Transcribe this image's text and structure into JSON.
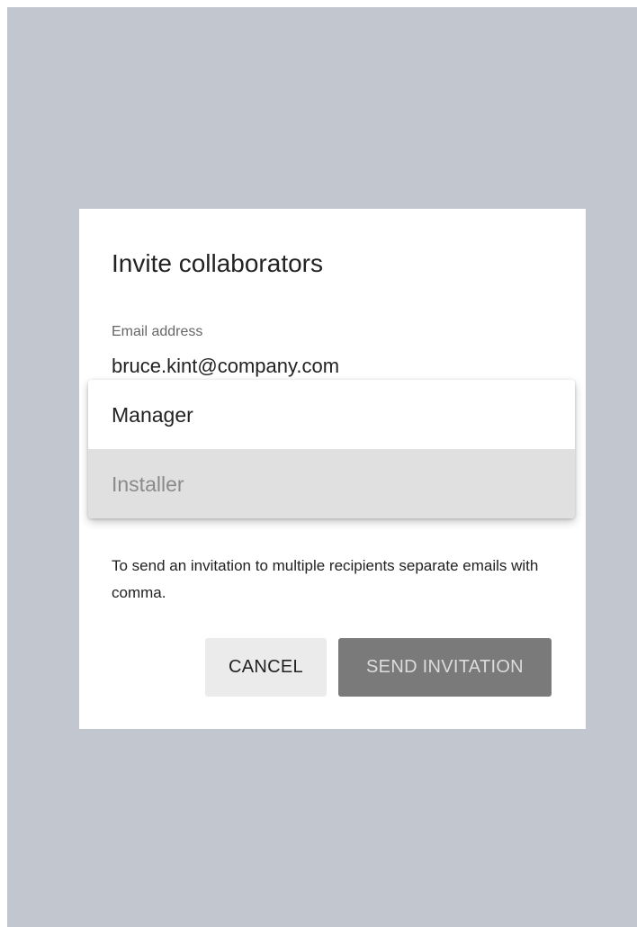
{
  "dialog": {
    "title": "Invite collaborators",
    "email_label": "Email address",
    "email_value": "bruce.kint@company.com",
    "role_menu": {
      "items": [
        {
          "label": "Manager",
          "selected": false
        },
        {
          "label": "Installer",
          "selected": true
        }
      ]
    },
    "helper_text": "To send an invitation to multiple recipients separate emails with comma.",
    "buttons": {
      "cancel_label": "CANCEL",
      "send_label": "SEND INVITATION"
    }
  },
  "colors": {
    "backdrop": "#c2c6ce",
    "dialog_bg": "#ffffff",
    "menu_selected_bg": "#e0e0e0",
    "send_button_bg": "#7a7a7a",
    "cancel_button_bg": "#ebebeb"
  }
}
